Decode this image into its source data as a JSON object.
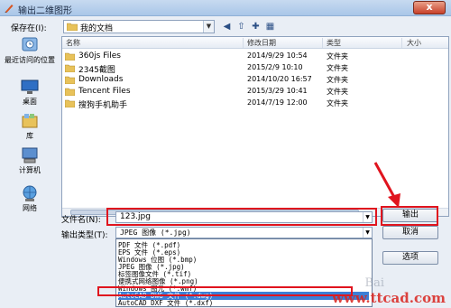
{
  "window": {
    "title": "输出二维图形",
    "close_glyph": "x"
  },
  "savein": {
    "label": "保存在(I):",
    "value": "我的文档"
  },
  "places": [
    {
      "label": "最近访问的位置",
      "icon": "recent-places-icon"
    },
    {
      "label": "桌面",
      "icon": "desktop-icon"
    },
    {
      "label": "库",
      "icon": "libraries-icon"
    },
    {
      "label": "计算机",
      "icon": "computer-icon"
    },
    {
      "label": "网络",
      "icon": "network-icon"
    }
  ],
  "columns": {
    "name": "名称",
    "date": "修改日期",
    "type": "类型",
    "size": "大小"
  },
  "files": [
    {
      "name": "360js Files",
      "date": "2014/9/29 10:54",
      "type": "文件夹"
    },
    {
      "name": "2345截图",
      "date": "2015/2/9 10:10",
      "type": "文件夹"
    },
    {
      "name": "Downloads",
      "date": "2014/10/20 16:57",
      "type": "文件夹"
    },
    {
      "name": "Tencent Files",
      "date": "2015/3/29 10:41",
      "type": "文件夹"
    },
    {
      "name": "搜狗手机助手",
      "date": "2014/7/19 12:00",
      "type": "文件夹"
    }
  ],
  "filename": {
    "label": "文件名(N):",
    "value": "123.jpg"
  },
  "filetype": {
    "label": "输出类型(T):",
    "value": "JPEG 图像 (*.jpg)",
    "options": [
      "PDF 文件 (*.pdf)",
      "EPS 文件 (*.eps)",
      "Windows 位图 (*.bmp)",
      "JPEG 图像 (*.jpg)",
      "标签图像文件 (*.tif)",
      "便携式网络图像 (*.png)",
      "Windows 图元 (*.wmf)",
      "AutoCAD DWG 文件 (*.dwg)",
      "AutoCAD DXF 文件 (*.dxf)"
    ],
    "selected_index": 7
  },
  "buttons": {
    "save": "输出",
    "cancel": "取消",
    "options": "选项"
  },
  "watermarks": {
    "site": "www.ttcad.com",
    "baidu": "Bai"
  },
  "colors": {
    "highlight": "#e0141e",
    "selection": "#3c7fd6"
  }
}
